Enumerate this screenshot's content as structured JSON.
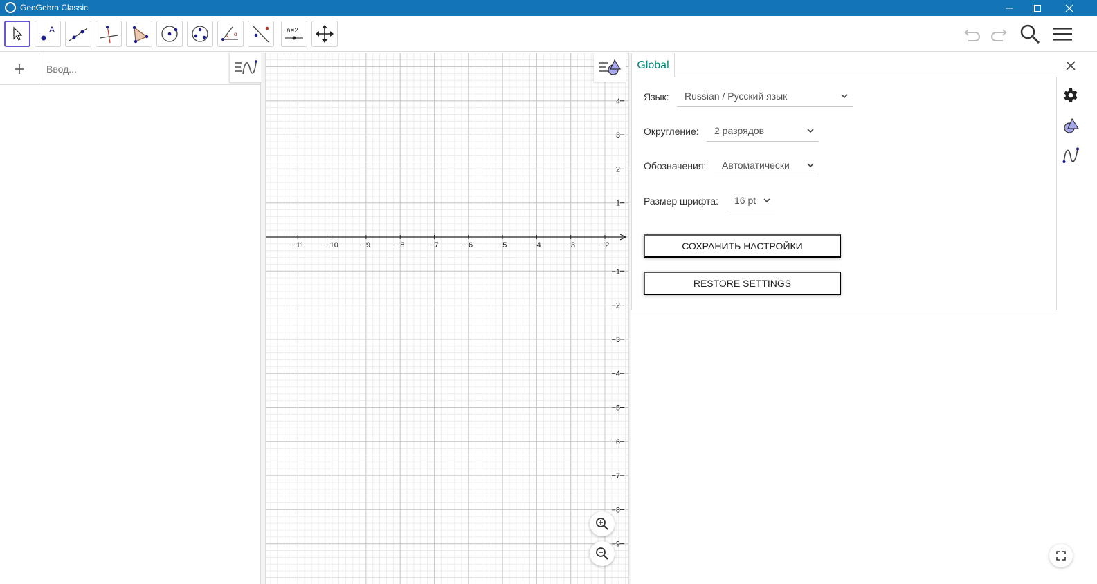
{
  "window": {
    "title": "GeoGebra Classic"
  },
  "toolbar": {
    "tools": [
      {
        "name": "move-tool-icon",
        "active": true
      },
      {
        "name": "point-tool-icon",
        "label": "A"
      },
      {
        "name": "line-tool-icon"
      },
      {
        "name": "perpendicular-line-tool-icon"
      },
      {
        "name": "polygon-tool-icon"
      },
      {
        "name": "circle-tool-icon"
      },
      {
        "name": "circle-three-points-tool-icon"
      },
      {
        "name": "angle-tool-icon"
      },
      {
        "name": "reflect-tool-icon"
      },
      {
        "name": "slider-tool-icon",
        "label": "a=2"
      },
      {
        "name": "move-graphics-view-tool-icon"
      }
    ]
  },
  "algebra": {
    "input_placeholder": "Ввод..."
  },
  "graphics": {
    "x_ticks": [
      "−11",
      "−10",
      "−9",
      "−8",
      "−7",
      "−6",
      "−5",
      "−4",
      "−3",
      "−2"
    ],
    "y_ticks_pos": [
      "4",
      "3",
      "2",
      "1"
    ],
    "y_ticks_neg": [
      "−1",
      "−2",
      "−3",
      "−4",
      "−5",
      "−6",
      "−7",
      "−8",
      "−9"
    ]
  },
  "settings": {
    "tab_label": "Global",
    "language": {
      "label": "Язык:",
      "value": "Russian / Русский язык"
    },
    "rounding": {
      "label": "Округление:",
      "value": "2 разрядов"
    },
    "labeling": {
      "label": "Обозначения:",
      "value": "Автоматически"
    },
    "font_size": {
      "label": "Размер шрифта:",
      "value": "16 pt"
    },
    "save_button": "СОХРАНИТЬ НАСТРОЙКИ",
    "restore_button": "RESTORE SETTINGS"
  },
  "colors": {
    "titlebar": "#1475b6",
    "accent": "#00897b",
    "active_tool": "#6557d2",
    "point": "#1b1b8c"
  }
}
